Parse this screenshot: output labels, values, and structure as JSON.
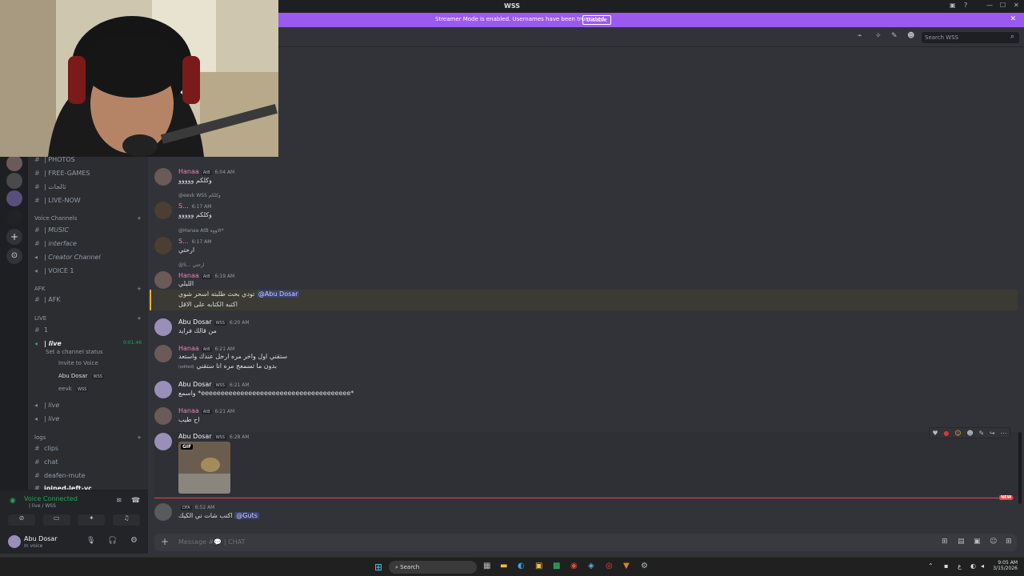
{
  "window": {
    "title": "WSS",
    "controls": [
      "▣",
      "?",
      "—",
      "☐",
      "✕"
    ]
  },
  "banner": {
    "message": "Streamer Mode is enabled. Usernames have been truncated.",
    "button": "Disable",
    "close": "✕"
  },
  "header": {
    "search_placeholder": "Search WSS"
  },
  "sidebar": {
    "channels_top": [
      {
        "name": "| PHOTOS"
      },
      {
        "name": "| FREE-GAMES"
      },
      {
        "name": "| ثالجات"
      },
      {
        "name": "| LIVE-NOW"
      }
    ],
    "voice_category": "Voice Channels",
    "voice_channels": [
      {
        "name": "| MUSIC"
      },
      {
        "name": "| interface"
      },
      {
        "name": "| Creator Channel"
      },
      {
        "name": "| VOICE 1"
      }
    ],
    "afk_category": "AFK",
    "afk_channel": "| AFK",
    "live_category": "LIVE",
    "live_channels": [
      {
        "name": "1"
      },
      {
        "name": "| live",
        "timer": "0:01:46",
        "status": "Set a channel status"
      }
    ],
    "invite_label": "Invite to Voice",
    "voice_users": [
      {
        "name": "Abu Dosar",
        "tag": "WSS"
      },
      {
        "name": "eevk",
        "tag": "WSS"
      }
    ],
    "more_live": [
      "| live",
      "| live"
    ],
    "logs_category": "logs",
    "logs_channels": [
      "clips",
      "chat",
      "deafen-mute",
      "joined-left-vc"
    ]
  },
  "voice_panel": {
    "status": "Voice Connected",
    "location": "| live / WSS"
  },
  "user_panel": {
    "name": "Abu Dosar",
    "status": "In voice"
  },
  "messages": [
    {
      "author": "Hanaa",
      "tag": "AtB",
      "time": "6:04 AM",
      "text": "وكلكم ووووو",
      "color": "#ee80bf"
    },
    {
      "author": "S...",
      "tag": "",
      "time": "6:17 AM",
      "reply": "@eevk WSS وكلكم",
      "text": "وكلكم ووووو",
      "color": "#ee80bf"
    },
    {
      "author": "S...",
      "tag": "",
      "time": "6:17 AM",
      "reply": "@Hanaa AtB الاووه*",
      "text": "ارحتي",
      "color": "#ee80bf"
    },
    {
      "author": "Hanaa",
      "tag": "AtB",
      "time": "6:19 AM",
      "reply": "@S... ارحتي",
      "text": "الليلي",
      "color": "#ee80bf"
    },
    {
      "author": "",
      "tag": "",
      "time": "",
      "text": "تودي بحث طلبته اسحر شوي",
      "mention": "@Abu Dosar",
      "text2": "اكتبه الكتابه على الاقل"
    },
    {
      "author": "Abu Dosar",
      "tag": "WSS",
      "time": "6:20 AM",
      "text": "من قالك فرايد",
      "color": "#dbdee1"
    },
    {
      "author": "Hanaa",
      "tag": "AtB",
      "time": "6:21 AM",
      "text": "ستقني اول واخر مره ارحل عندك واستعد",
      "text2": "بدون ما تسمعج مره انا ستقني",
      "edited": "(edited)",
      "color": "#ee80bf"
    },
    {
      "author": "Abu Dosar",
      "tag": "WSS",
      "time": "6:21 AM",
      "text": "واسمع *eeeeeeeeeeeeeeeeeeeeeeeeeeeeeeeeeeeeee*",
      "color": "#dbdee1"
    },
    {
      "author": "Hanaa",
      "tag": "AtB",
      "time": "6:21 AM",
      "text": "اح طيب",
      "color": "#ee80bf"
    },
    {
      "author": "Abu Dosar",
      "tag": "WSS",
      "time": "6:28 AM",
      "gif": "GIF",
      "color": "#dbdee1"
    },
    {
      "author": "",
      "tag": "DFA",
      "time": "6:52 AM",
      "text": "اكتب شات ني الكيك",
      "mention": "@Guts",
      "color": "#dbdee1"
    }
  ],
  "new_label": "NEW",
  "composer": {
    "placeholder": "Message #💬 | CHAT"
  },
  "taskbar": {
    "search": "Search",
    "time": "9:05 AM",
    "date": "3/15/2026",
    "lang": "ع"
  }
}
